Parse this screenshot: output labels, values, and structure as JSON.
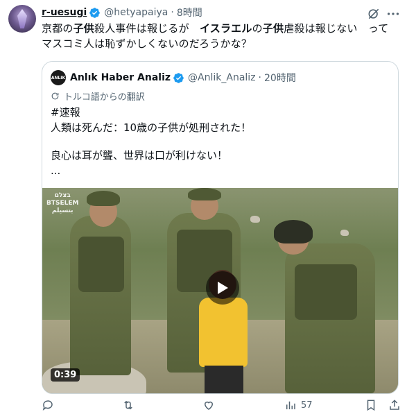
{
  "tweet": {
    "author_name": "r-uesugi",
    "author_handle": "@hetyapaiya",
    "separator": "·",
    "time": "8時間",
    "text_parts": [
      {
        "text": "京都の",
        "bold": false
      },
      {
        "text": "子供",
        "bold": true
      },
      {
        "text": "殺人事件は報じるが　",
        "bold": false
      },
      {
        "text": "イスラエル",
        "bold": true
      },
      {
        "text": "の",
        "bold": false
      },
      {
        "text": "子供",
        "bold": true
      },
      {
        "text": "虐殺は報じない　ってマスコミ人は恥ずかしくないのだろうかな？",
        "bold": false
      }
    ]
  },
  "quote": {
    "avatar_text": "ANLIK",
    "author_name": "Anlık Haber Analiz",
    "author_handle": "@Anlik_Analiz",
    "separator": "·",
    "time": "20時間",
    "translated_label": "トルコ語からの翻訳",
    "lines": [
      "#速報",
      "人類は死んだ：10歳の子供が処刑された！",
      "",
      "良心は耳が聾、世界は口が利けない！",
      "..."
    ],
    "video": {
      "duration": "0:39",
      "watermark_line1": "בצלם",
      "watermark_line2": "BTSELEM",
      "watermark_line3": "بتسيلم"
    }
  },
  "actions": {
    "views_count": "57"
  },
  "colors": {
    "verified": "#1d9bf0",
    "muted": "#536471",
    "border": "#cfd9de"
  }
}
